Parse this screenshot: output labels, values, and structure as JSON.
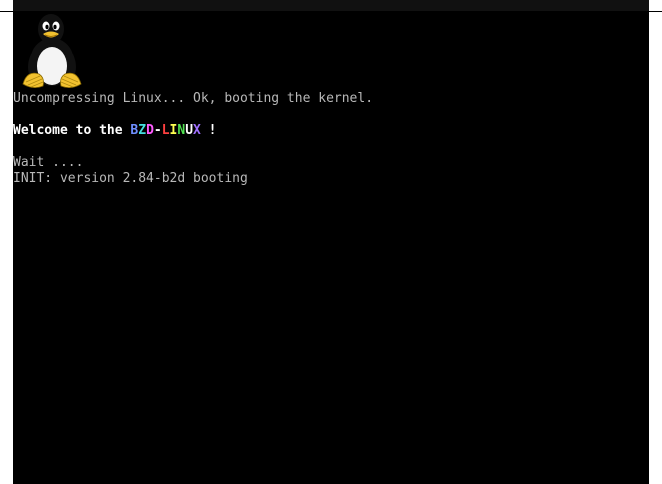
{
  "console": {
    "logo_icon": "tux-penguin-icon",
    "lines": {
      "uncompress": "Uncompressing Linux... Ok, booting the kernel.",
      "welcome_prefix": "Welcome to the ",
      "welcome_suffix": " !",
      "wait": "Wait ....",
      "init": "INIT: version 2.84-b2d booting"
    },
    "distro_name": {
      "letters": [
        "B",
        "Z",
        "D",
        "-",
        "L",
        "I",
        "N",
        "U",
        "X"
      ],
      "colors": [
        "#6f8fff",
        "#44e0e0",
        "#ff5bff",
        "#ffffff",
        "#ff4040",
        "#ffff50",
        "#50e050",
        "#ffffff",
        "#a070ff"
      ]
    },
    "colors": {
      "background": "#000000",
      "text": "#b8b8b8",
      "highlight": "#ffffff"
    }
  }
}
